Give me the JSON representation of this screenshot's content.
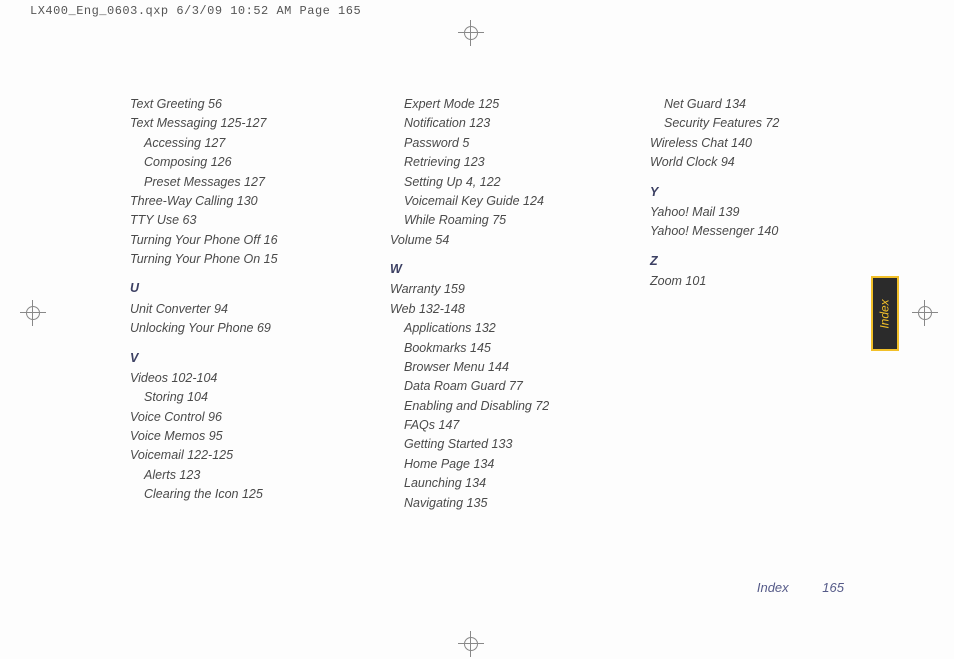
{
  "header": "LX400_Eng_0603.qxp  6/3/09  10:52 AM  Page 165",
  "side_tab": "Index",
  "footer": {
    "label": "Index",
    "page": "165"
  },
  "columns": [
    [
      {
        "t": "entry",
        "text": "Text Greeting 56"
      },
      {
        "t": "entry",
        "text": "Text Messaging 125-127"
      },
      {
        "t": "sub",
        "text": "Accessing 127"
      },
      {
        "t": "sub",
        "text": "Composing 126"
      },
      {
        "t": "sub",
        "text": "Preset Messages 127"
      },
      {
        "t": "entry",
        "text": "Three-Way Calling 130"
      },
      {
        "t": "entry",
        "text": "TTY Use 63"
      },
      {
        "t": "entry",
        "text": "Turning Your Phone Off 16"
      },
      {
        "t": "entry",
        "text": "Turning Your Phone On 15"
      },
      {
        "t": "letter",
        "text": "U"
      },
      {
        "t": "entry",
        "text": "Unit Converter 94"
      },
      {
        "t": "entry",
        "text": "Unlocking Your Phone 69"
      },
      {
        "t": "letter",
        "text": "V"
      },
      {
        "t": "entry",
        "text": "Videos 102-104"
      },
      {
        "t": "sub",
        "text": "Storing 104"
      },
      {
        "t": "entry",
        "text": "Voice Control 96"
      },
      {
        "t": "entry",
        "text": "Voice Memos 95"
      },
      {
        "t": "entry",
        "text": "Voicemail 122-125"
      },
      {
        "t": "sub",
        "text": "Alerts 123"
      },
      {
        "t": "sub",
        "text": "Clearing the Icon 125"
      }
    ],
    [
      {
        "t": "sub",
        "text": "Expert Mode 125"
      },
      {
        "t": "sub",
        "text": "Notification 123"
      },
      {
        "t": "sub",
        "text": "Password 5"
      },
      {
        "t": "sub",
        "text": "Retrieving 123"
      },
      {
        "t": "sub",
        "text": "Setting Up 4,  122"
      },
      {
        "t": "sub",
        "text": "Voicemail Key Guide 124"
      },
      {
        "t": "sub",
        "text": "While Roaming 75"
      },
      {
        "t": "entry",
        "text": "Volume 54"
      },
      {
        "t": "letter",
        "text": "W"
      },
      {
        "t": "entry",
        "text": "Warranty 159"
      },
      {
        "t": "entry",
        "text": "Web 132-148"
      },
      {
        "t": "sub",
        "text": "Applications 132"
      },
      {
        "t": "sub",
        "text": "Bookmarks 145"
      },
      {
        "t": "sub",
        "text": "Browser Menu 144"
      },
      {
        "t": "sub",
        "text": "Data Roam Guard 77"
      },
      {
        "t": "sub",
        "text": "Enabling and Disabling 72"
      },
      {
        "t": "sub",
        "text": "FAQs 147"
      },
      {
        "t": "sub",
        "text": "Getting Started 133"
      },
      {
        "t": "sub",
        "text": "Home Page 134"
      },
      {
        "t": "sub",
        "text": "Launching 134"
      },
      {
        "t": "sub",
        "text": "Navigating 135"
      }
    ],
    [
      {
        "t": "sub",
        "text": "Net Guard 134"
      },
      {
        "t": "sub",
        "text": "Security Features 72"
      },
      {
        "t": "entry",
        "text": "Wireless Chat 140"
      },
      {
        "t": "entry",
        "text": "World Clock 94"
      },
      {
        "t": "letter",
        "text": "Y"
      },
      {
        "t": "entry",
        "text": "Yahoo! Mail 139"
      },
      {
        "t": "entry",
        "text": "Yahoo! Messenger 140"
      },
      {
        "t": "letter",
        "text": "Z"
      },
      {
        "t": "entry",
        "text": "Zoom 101"
      }
    ]
  ]
}
